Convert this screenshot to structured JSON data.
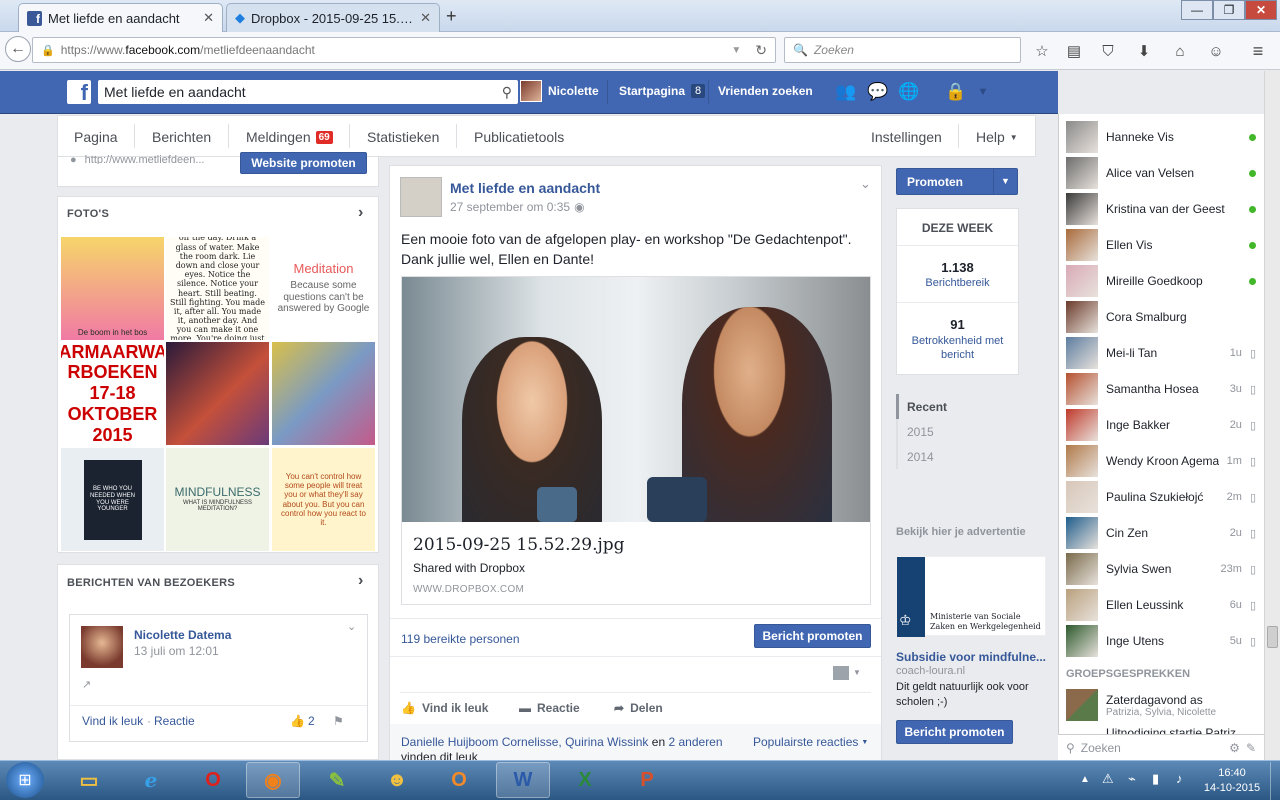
{
  "browser": {
    "tabs": [
      {
        "title": "Met liefde en aandacht",
        "active": true
      },
      {
        "title": "Dropbox - 2015-09-25 15.5...",
        "active": false
      }
    ],
    "url_prefix": "https://www.",
    "url_domain": "facebook.com",
    "url_path": "/metliefdeenaandacht",
    "search_placeholder": "Zoeken"
  },
  "fb_header": {
    "search_value": "Met liefde en aandacht",
    "user_name": "Nicolette",
    "home_label": "Startpagina",
    "home_count": "8",
    "find_friends": "Vrienden zoeken"
  },
  "page_tabs": {
    "items": [
      "Pagina",
      "Berichten",
      "Meldingen",
      "Statistieken",
      "Publicatietools"
    ],
    "notifications_badge": "69",
    "settings": "Instellingen",
    "help": "Help"
  },
  "left": {
    "partial_url": "http://www.metliefdeen...",
    "promote_website": "Website promoten",
    "photos_title": "FOTO'S",
    "photos": [
      {
        "text": "De boom in het bos"
      },
      {
        "text": "Take a shower, wash off the day. Drink a glass of water. Make the room dark. Lie down and close your eyes. Notice the silence. Notice your heart. Still beating. Still fighting. You made it, after all. You made it, another day. And you can make it one more. You're doing just fine."
      },
      {
        "title": "Meditation",
        "text": "Because some questions can't be answered by Google"
      },
      {
        "text": "ARMAARWA RBOEKEN 17-18 OKTOBER 2015"
      },
      {
        "text": ""
      },
      {
        "text": ""
      },
      {
        "text": "BE WHO YOU NEEDED WHEN YOU WERE YOUNGER"
      },
      {
        "title": "MINDFULNESS",
        "text": "WHAT IS MINDFULNESS MEDITATION?"
      },
      {
        "text": "You can't control how some people will treat you or what they'll say about you. But you can control how you react to it."
      }
    ],
    "visitors_title": "BERICHTEN VAN BEZOEKERS",
    "visitor": {
      "name": "Nicolette Datema",
      "date": "13 juli om 12:01",
      "like": "Vind ik leuk",
      "comment": "Reactie",
      "likes": "2"
    }
  },
  "post": {
    "page_name": "Met liefde en aandacht",
    "date": "27 september om 0:35",
    "text": "Een mooie foto van de afgelopen play- en workshop \"De Gedachtenpot\". Dank jullie wel, Ellen en Dante!",
    "link_title": "2015-09-25 15.52.29.jpg",
    "link_sub": "Shared with Dropbox",
    "link_domain": "WWW.DROPBOX.COM",
    "reach": "119 bereikte personen",
    "promote_post": "Bericht promoten",
    "actions": {
      "like": "Vind ik leuk",
      "comment": "Reactie",
      "share": "Delen"
    },
    "likers": "Danielle Huijboom Cornelisse, Quirina Wissink",
    "likers_and": "en",
    "likers_others": "2 anderen",
    "likers_suffix": "vinden dit leuk",
    "popular": "Populairste reacties"
  },
  "right": {
    "promote": "Promoten",
    "week_title": "DEZE WEEK",
    "reach_value": "1.138",
    "reach_label": "Berichtbereik",
    "engage_value": "91",
    "engage_label": "Betrokkenheid met bericht",
    "years": [
      "Recent",
      "2015",
      "2014"
    ],
    "ad_header": "Bekijk hier je advertentie",
    "ad_ministry": "Ministerie van Sociale Zaken en Werkgelegenheid",
    "ad_title": "Subsidie voor mindfulne...",
    "ad_domain": "coach-loura.nl",
    "ad_text": "Dit geldt natuurlijk ook voor scholen ;-)",
    "ad_button": "Bericht promoten"
  },
  "chat": {
    "contacts": [
      {
        "name": "Hanneke Vis",
        "online": true,
        "ago": "",
        "color": "#8a8a8a"
      },
      {
        "name": "Alice van Velsen",
        "online": true,
        "ago": "",
        "color": "#6d6d6d"
      },
      {
        "name": "Kristina van der Geest",
        "online": true,
        "ago": "",
        "color": "#3a3a3a"
      },
      {
        "name": "Ellen Vis",
        "online": true,
        "ago": "",
        "color": "#a86a3a"
      },
      {
        "name": "Mireille Goedkoop",
        "online": true,
        "ago": "",
        "color": "#d9a9b6"
      },
      {
        "name": "Cora Smalburg",
        "online": false,
        "ago": "",
        "color": "#6b3a2a"
      },
      {
        "name": "Mei-li Tan",
        "online": false,
        "ago": "1u",
        "color": "#5c7da0"
      },
      {
        "name": "Samantha Hosea",
        "online": false,
        "ago": "3u",
        "color": "#b5502f"
      },
      {
        "name": "Inge Bakker",
        "online": false,
        "ago": "2u",
        "color": "#c0392b"
      },
      {
        "name": "Wendy Kroon Agema",
        "online": false,
        "ago": "1m",
        "color": "#b07a4a"
      },
      {
        "name": "Paulina Szukiełojć",
        "online": false,
        "ago": "2m",
        "color": "#d8c6b8"
      },
      {
        "name": "Cin Zen",
        "online": false,
        "ago": "2u",
        "color": "#1f5d8c"
      },
      {
        "name": "Sylvia Swen",
        "online": false,
        "ago": "23m",
        "color": "#7a6a4a"
      },
      {
        "name": "Ellen Leussink",
        "online": false,
        "ago": "6u",
        "color": "#b9a07d"
      },
      {
        "name": "Inge Utens",
        "online": false,
        "ago": "5u",
        "color": "#2d5a2d"
      }
    ],
    "groups_title": "GROEPSGESPREKKEN",
    "group": {
      "name": "Zaterdagavond as",
      "members": "Patrizia, Sylvia, Nicolette"
    },
    "group2": "Uitnodiging startje Patriz...",
    "search_placeholder": "Zoeken"
  },
  "taskbar": {
    "time": "16:40",
    "date": "14-10-2015"
  }
}
